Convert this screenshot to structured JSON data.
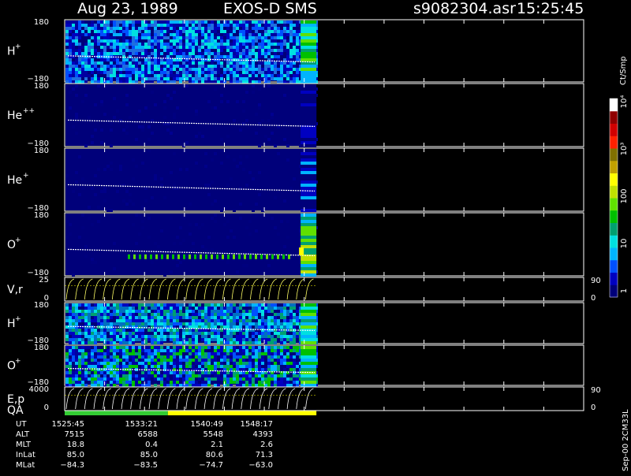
{
  "header": {
    "date": "Aug 23, 1989",
    "instrument": "EXOS-D SMS",
    "file": "s9082304.asr",
    "time": "15:25:45"
  },
  "colorbar": {
    "unit": "Ct/Smp",
    "ticks": [
      {
        "value": 1,
        "label": "1"
      },
      {
        "value": 10,
        "label": "10"
      },
      {
        "value": 100,
        "label": "100"
      },
      {
        "value": 1000,
        "label": "10³"
      },
      {
        "value": 10000,
        "label": "10⁴"
      }
    ],
    "colors": [
      "#00007a",
      "#0000c0",
      "#0050ff",
      "#00b4ff",
      "#00e0e0",
      "#00a070",
      "#00c000",
      "#60e000",
      "#c0e000",
      "#ffff00",
      "#c0a000",
      "#807000",
      "#ff2000",
      "#d00000",
      "#900000",
      "#ffffff"
    ]
  },
  "footer_label": "Sep-00 2CM33L",
  "chart_data": {
    "type": "heatmap",
    "panels": [
      {
        "id": "h-plus-1",
        "label": "H",
        "sup": "+",
        "ylim": [
          -180,
          180
        ],
        "ticks": [
          "180",
          "−180"
        ]
      },
      {
        "id": "he-plus-plus",
        "label": "He",
        "sup": "++",
        "ylim": [
          -180,
          180
        ],
        "ticks": [
          "180",
          "−180"
        ]
      },
      {
        "id": "he-plus",
        "label": "He",
        "sup": "+",
        "ylim": [
          -180,
          180
        ],
        "ticks": [
          "180",
          "−180"
        ]
      },
      {
        "id": "o-plus-1",
        "label": "O",
        "sup": "+",
        "ylim": [
          -180,
          180
        ],
        "ticks": [
          "180",
          "−180"
        ]
      },
      {
        "id": "v-r",
        "label": "V,r",
        "sup": "",
        "ylim": [
          0,
          25
        ],
        "ticks": [
          "25",
          "0"
        ],
        "right_ticks": [
          "90",
          "0"
        ]
      },
      {
        "id": "h-plus-2",
        "label": "H",
        "sup": "+",
        "ylim": [
          -180,
          180
        ],
        "ticks": [
          "180",
          "−180"
        ]
      },
      {
        "id": "o-plus-2",
        "label": "O",
        "sup": "+",
        "ylim": [
          -180,
          180
        ],
        "ticks": [
          "180",
          "−180"
        ]
      },
      {
        "id": "e-p",
        "label": "E,p",
        "sup": "",
        "ylim": [
          0,
          4000
        ],
        "ticks": [
          "4000",
          "0"
        ],
        "right_ticks": [
          "90",
          "0"
        ]
      }
    ],
    "qa_label": "QA",
    "qa_segments": [
      {
        "from": 0,
        "to": 0.41,
        "color": "#33cc33"
      },
      {
        "from": 0.41,
        "to": 1.0,
        "color": "#ffff00"
      }
    ],
    "data_end_fraction": 0.485,
    "x_ticks_count": 13,
    "ephemeris": {
      "rows": [
        "UT",
        "ALT",
        "MLT",
        "InLat",
        "MLat"
      ],
      "columns": [
        [
          "1525:45",
          "7515",
          "18.8",
          "85.0",
          "−84.3"
        ],
        [
          "1533:21",
          "6588",
          "0.4",
          "85.0",
          "−83.5"
        ],
        [
          "1540:49",
          "5548",
          "2.1",
          "80.6",
          "−74.7"
        ],
        [
          "1548:17",
          "4393",
          "2.6",
          "71.3",
          "−63.0"
        ]
      ]
    }
  }
}
